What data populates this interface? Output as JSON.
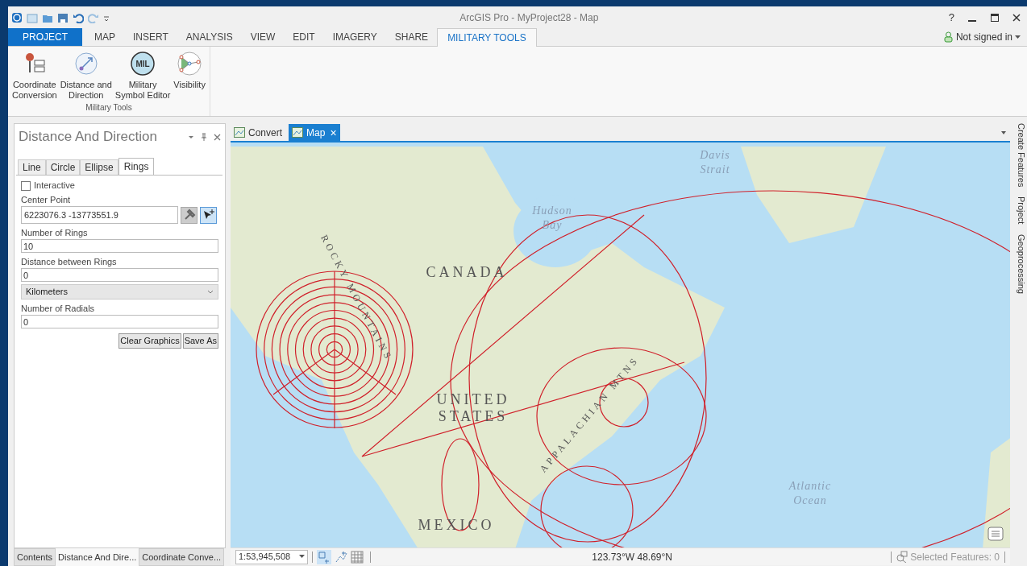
{
  "window": {
    "title": "ArcGIS Pro - MyProject28 - Map",
    "help": "?"
  },
  "ribbon": {
    "tabs": [
      {
        "label": "PROJECT",
        "kind": "backstage",
        "selected": false
      },
      {
        "label": "MAP",
        "kind": "tab",
        "selected": false
      },
      {
        "label": "INSERT",
        "kind": "tab",
        "selected": false
      },
      {
        "label": "ANALYSIS",
        "kind": "tab",
        "selected": false
      },
      {
        "label": "VIEW",
        "kind": "tab",
        "selected": false
      },
      {
        "label": "EDIT",
        "kind": "tab",
        "selected": false
      },
      {
        "label": "IMAGERY",
        "kind": "tab",
        "selected": false
      },
      {
        "label": "SHARE",
        "kind": "tab",
        "selected": false
      },
      {
        "label": "MILITARY TOOLS",
        "kind": "tab",
        "selected": true
      }
    ],
    "account": "Not signed in",
    "group": {
      "label": "Military Tools",
      "buttons": [
        {
          "label": "Coordinate\nConversion",
          "kind": "coordinate"
        },
        {
          "label": "Distance and\nDirection",
          "kind": "distance"
        },
        {
          "label": "Military\nSymbol Editor",
          "kind": "symbol",
          "badge": "MIL"
        },
        {
          "label": "Visibility",
          "kind": "visibility"
        }
      ]
    }
  },
  "pane": {
    "title": "Distance And Direction",
    "tabs": [
      {
        "label": "Line",
        "selected": false
      },
      {
        "label": "Circle",
        "selected": false
      },
      {
        "label": "Ellipse",
        "selected": false
      },
      {
        "label": "Rings",
        "selected": true
      }
    ],
    "interactive": {
      "label": "Interactive",
      "checked": false
    },
    "center_point": {
      "label": "Center Point",
      "value": "6223076.3 -13773551.9"
    },
    "number_of_rings": {
      "label": "Number of Rings",
      "value": "10"
    },
    "distance_between_rings": {
      "label": "Distance between Rings",
      "value": "0"
    },
    "units": "Kilometers",
    "number_of_radials": {
      "label": "Number of Radials",
      "value": "0"
    },
    "buttons": [
      "Clear Graphics",
      "Save As"
    ],
    "bottom_tabs": [
      {
        "label": "Contents",
        "selected": false
      },
      {
        "label": "Distance And Dire...",
        "selected": true
      },
      {
        "label": "Coordinate Conve...",
        "selected": false
      }
    ]
  },
  "map_view": {
    "tabs": [
      {
        "label": "Convert",
        "selected": false
      },
      {
        "label": "Map",
        "selected": true
      }
    ],
    "labels": [
      "Davis\nStrait",
      "Hudson\nBay",
      "CANADA",
      "UNITED\nSTATES",
      "MEXICO",
      "Atlantic\nOcean",
      "ROCKY MOUNTAINS",
      "APPALACHIAN MTNS"
    ],
    "close_glyph": "×"
  },
  "status_bar": {
    "scale": "1:53,945,508",
    "coordinates": "123.73°W 48.69°N",
    "selected_features": "Selected Features: 0"
  },
  "side_tabs": [
    "Create Features",
    "Project",
    "Geoprocessing"
  ]
}
